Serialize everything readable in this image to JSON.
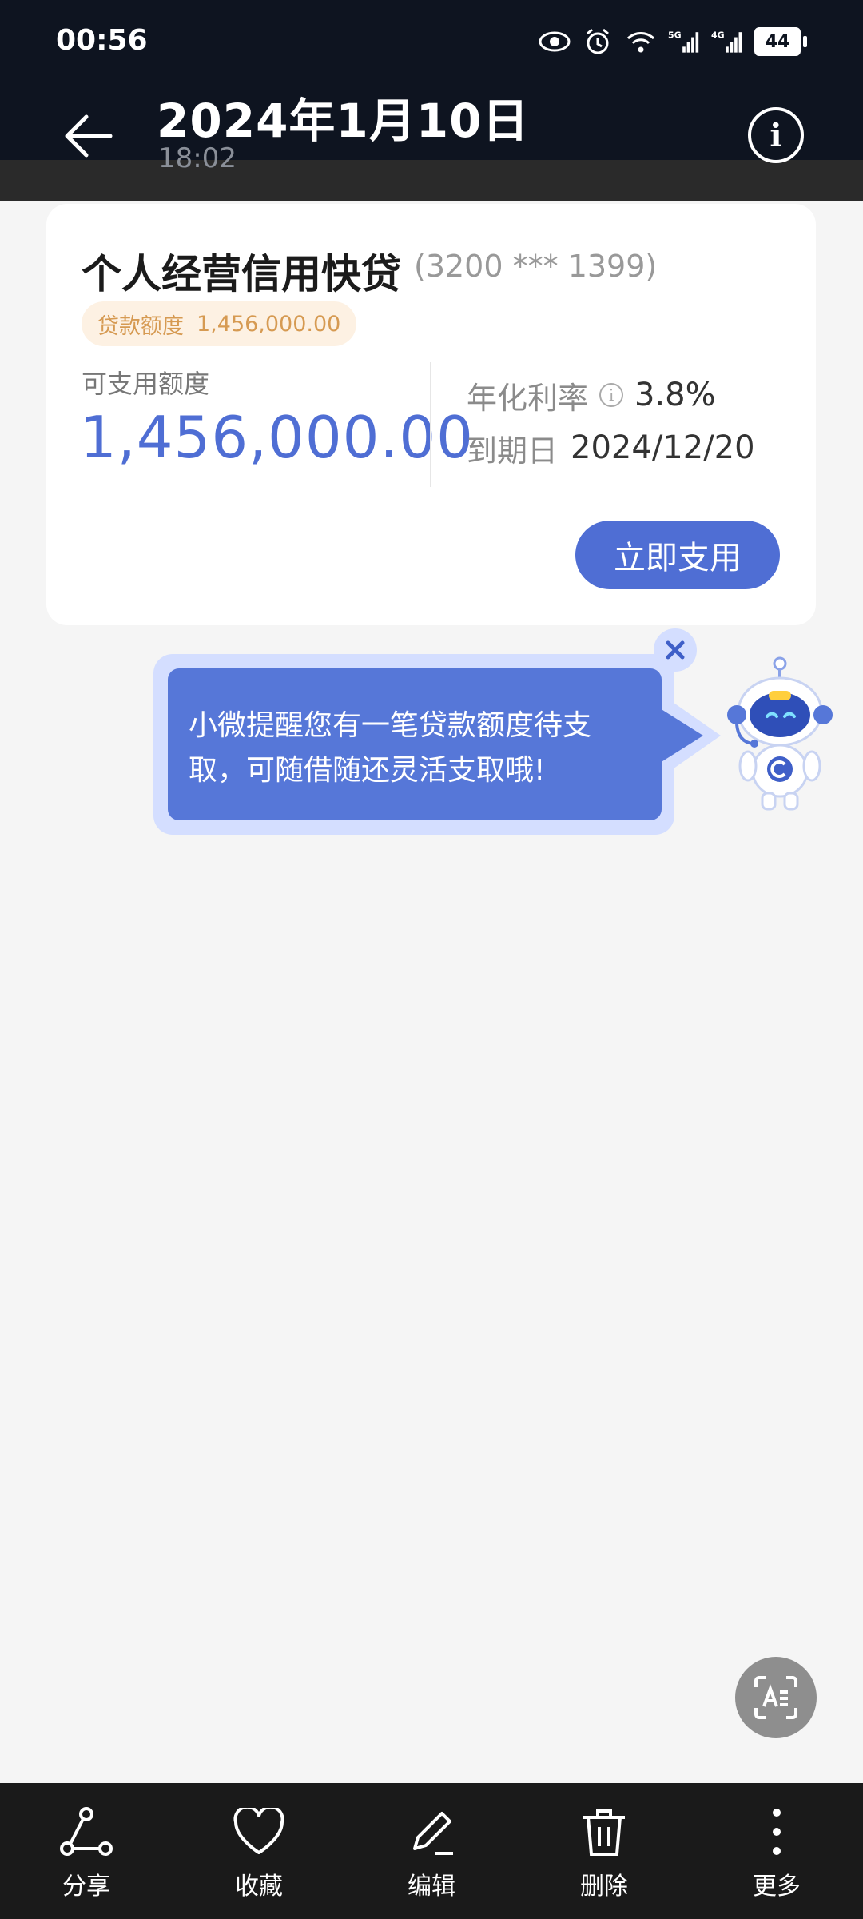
{
  "status_bar": {
    "time": "00:56",
    "battery": "44",
    "icons": [
      "eye-icon",
      "alarm-icon",
      "wifi-icon",
      "signal-5g-icon",
      "signal-4g-icon",
      "battery-icon"
    ]
  },
  "header": {
    "title": "2024年1月10日",
    "subtitle": "18:02"
  },
  "loan_card": {
    "product_name": "个人经营信用快贷",
    "account": "(3200 *** 1399)",
    "quota_tag_label": "贷款额度",
    "quota_tag_value": "1,456,000.00",
    "available_label": "可支用额度",
    "available_amount": "1,456,000.00",
    "rate_label": "年化利率",
    "rate_value": "3.8%",
    "due_label": "到期日",
    "due_value": "2024/12/20",
    "use_button": "立即支用"
  },
  "tooltip": {
    "line1": "小微提醒您有一笔贷款额度待支",
    "line2": "取，可随借随还灵活支取哦!"
  },
  "bottom_bar": {
    "items": [
      {
        "label": "分享",
        "icon": "share-icon"
      },
      {
        "label": "收藏",
        "icon": "heart-icon"
      },
      {
        "label": "编辑",
        "icon": "edit-icon"
      },
      {
        "label": "删除",
        "icon": "trash-icon"
      },
      {
        "label": "更多",
        "icon": "more-icon"
      }
    ]
  },
  "colors": {
    "accent": "#4f6ed4",
    "topbar": "#0e1420",
    "quota_tag_bg": "#fdf1e3",
    "quota_tag_text": "#d69a52"
  }
}
